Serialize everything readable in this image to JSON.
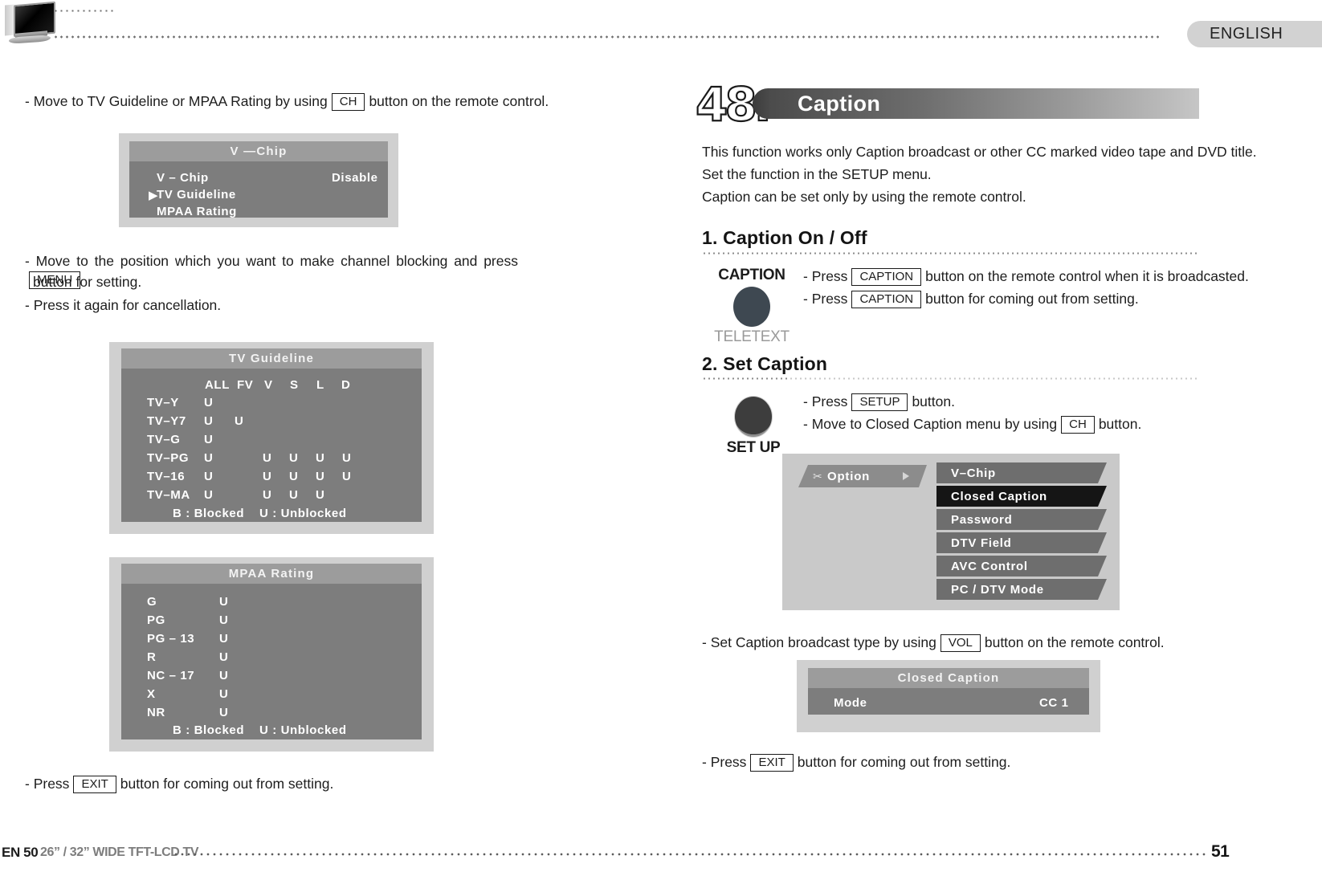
{
  "header": {
    "language_tab": "ENGLISH",
    "tv_icon": "tv-icon"
  },
  "left_column": {
    "line1": {
      "pre": "- Move to TV Guideline or MPAA Rating by using",
      "key": "CH",
      "post": "button on the remote control."
    },
    "vchip_panel": {
      "title": "V —Chip",
      "rows": [
        {
          "label": "V – Chip",
          "value": "Disable",
          "cursor": false
        },
        {
          "label": "TV  Guideline",
          "value": "",
          "cursor": true
        },
        {
          "label": "MPAA  Rating",
          "value": "",
          "cursor": false
        }
      ]
    },
    "line2": {
      "pre": "- Move to the position which you want to make channel blocking and press",
      "key": "MENU",
      "post": "button for setting."
    },
    "line3": "- Press it again for cancellation.",
    "tv_guideline_panel": {
      "title": "TV Guideline",
      "columns": [
        "ALL",
        "FV",
        "V",
        "S",
        "L",
        "D"
      ],
      "rows": [
        {
          "label": "TV–Y",
          "cells": [
            "U",
            "",
            "",
            "",
            "",
            ""
          ]
        },
        {
          "label": "TV–Y7",
          "cells": [
            "U",
            "U",
            "",
            "",
            "",
            ""
          ]
        },
        {
          "label": "TV–G",
          "cells": [
            "U",
            "",
            "",
            "",
            "",
            ""
          ]
        },
        {
          "label": "TV–PG",
          "cells": [
            "U",
            "",
            "U",
            "U",
            "U",
            "U"
          ]
        },
        {
          "label": "TV–16",
          "cells": [
            "U",
            "",
            "U",
            "U",
            "U",
            "U"
          ]
        },
        {
          "label": "TV–MA",
          "cells": [
            "U",
            "",
            "U",
            "U",
            "U",
            ""
          ]
        }
      ],
      "legend_blocked": "B : Blocked",
      "legend_unblocked": "U : Unblocked"
    },
    "mpaa_panel": {
      "title": "MPAA  Rating",
      "rows": [
        {
          "label": "G",
          "value": "U"
        },
        {
          "label": "PG",
          "value": "U"
        },
        {
          "label": "PG – 13",
          "value": "U"
        },
        {
          "label": "R",
          "value": "U"
        },
        {
          "label": "NC – 17",
          "value": "U"
        },
        {
          "label": "X",
          "value": "U"
        },
        {
          "label": "NR",
          "value": "U"
        }
      ],
      "legend_blocked": "B : Blocked",
      "legend_unblocked": "U : Unblocked"
    },
    "line4": {
      "pre": "- Press",
      "key": "EXIT",
      "post": "button for coming out from setting."
    }
  },
  "right_column": {
    "section_number": "48.",
    "section_title": "Caption",
    "intro": [
      "This function works only Caption broadcast or other CC marked video tape and DVD title.",
      "Set the function in the SETUP menu.",
      "Caption can be set only by using the remote control."
    ],
    "sub1": {
      "heading": "1. Caption On / Off",
      "key_art_top": "CAPTION",
      "key_art_bottom": "TELETEXT",
      "lines": [
        {
          "pre": "- Press",
          "key": "CAPTION",
          "post": "button on the remote control when it is broadcasted."
        },
        {
          "pre": "- Press",
          "key": "CAPTION",
          "post": "button for coming out from setting."
        }
      ]
    },
    "sub2": {
      "heading": "2. Set Caption",
      "key_art_label": "SET UP",
      "lines": [
        {
          "pre": "- Press",
          "key": "SETUP",
          "post": "button."
        },
        {
          "pre": "- Move to Closed Caption menu by using",
          "key": "CH",
          "post": "button."
        }
      ],
      "option_menu": {
        "tab_label": "Option",
        "tab_icon": "scissors-icon",
        "items": [
          {
            "label": "V–Chip",
            "selected": false
          },
          {
            "label": "Closed Caption",
            "selected": true
          },
          {
            "label": "Password",
            "selected": false
          },
          {
            "label": "DTV  Field",
            "selected": false
          },
          {
            "label": "AVC Control",
            "selected": false
          },
          {
            "label": "PC / DTV Mode",
            "selected": false
          }
        ]
      },
      "line_vol": {
        "pre": "- Set Caption broadcast type by using",
        "key": "VOL",
        "post": "button on the remote control."
      },
      "cc_panel": {
        "title": "Closed Caption",
        "row_label": "Mode",
        "row_value": "CC 1"
      },
      "line_exit": {
        "pre": "- Press",
        "key": "EXIT",
        "post": "button for coming out from setting."
      }
    }
  },
  "footer": {
    "left_code": "EN 50",
    "model": "26” / 32” WIDE TFT-LCD TV",
    "page_number": "51"
  },
  "colors": {
    "osd_bg": "#d0d0d0",
    "osd_panel": "#7d7d7d",
    "osd_title": "#9c9c9c",
    "selected_item": "#151515",
    "accent_gray": "#6e6e6e"
  }
}
